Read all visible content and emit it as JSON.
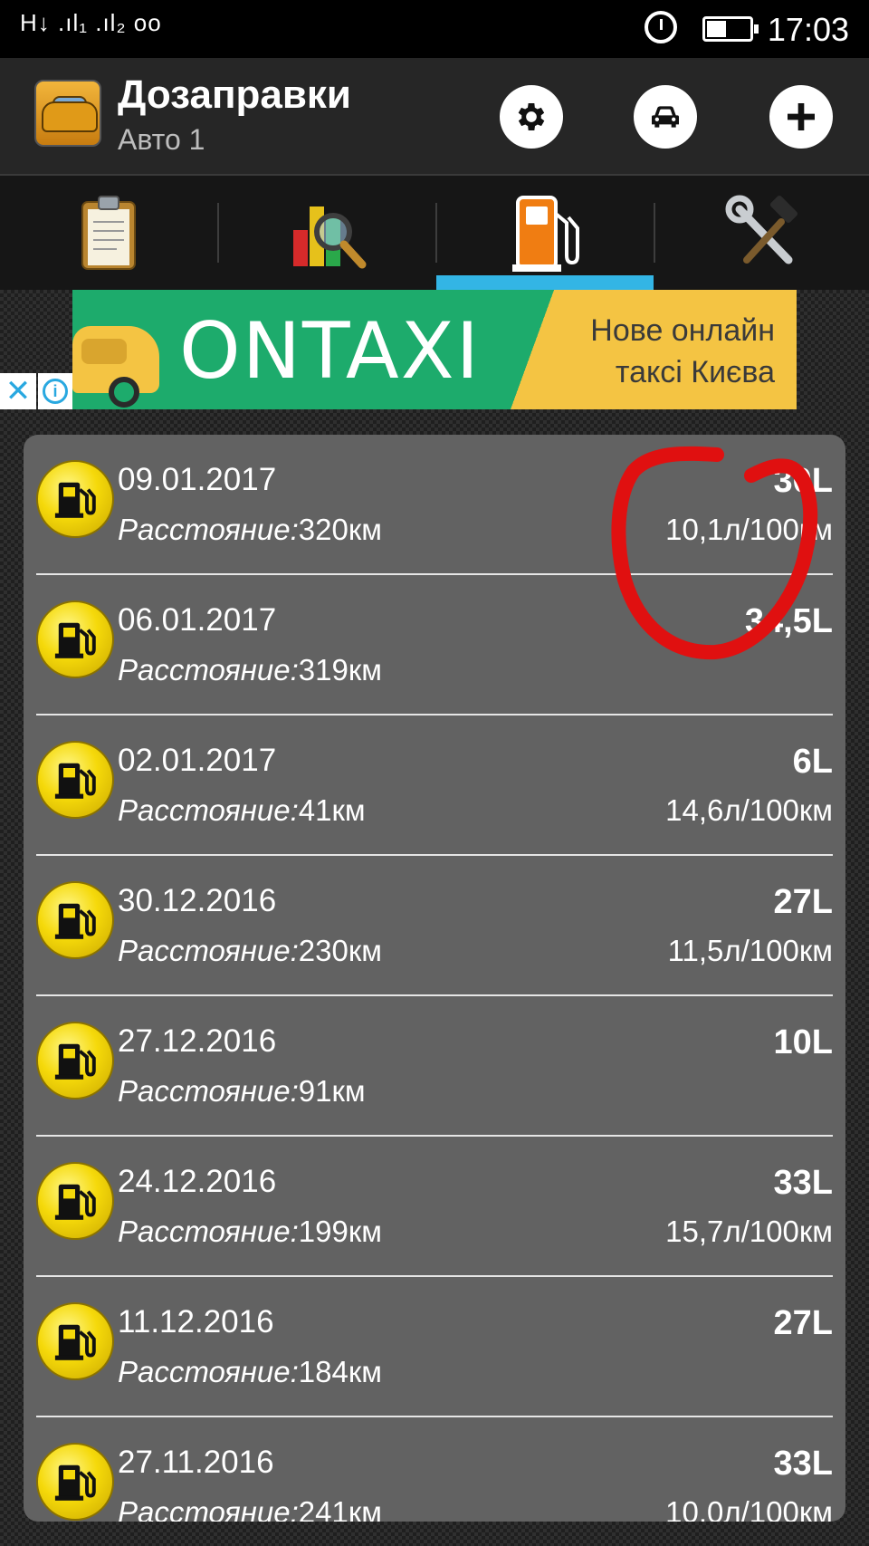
{
  "status_bar": {
    "left": "H↓ .ıl₁ .ıl₂ oo",
    "time": "17:03",
    "battery_level": 0.45
  },
  "header": {
    "title": "Дозаправки",
    "subtitle": "Авто 1"
  },
  "toolbar": {
    "settings_icon": "gear-icon",
    "car_icon": "car-icon",
    "add_icon": "plus-icon"
  },
  "tabs": [
    {
      "icon": "clipboard-icon",
      "selected": false
    },
    {
      "icon": "chart-search-icon",
      "selected": false
    },
    {
      "icon": "fuel-pump-icon",
      "selected": true
    },
    {
      "icon": "tools-icon",
      "selected": false
    }
  ],
  "ad": {
    "logo": "ONTAXI",
    "text": "Нове онлайн таксі Києва",
    "close": "✕",
    "info": "i"
  },
  "colors": {
    "accent": "#33b5e5",
    "list_bg": "#626262",
    "fuel_icon": "#f5d90a",
    "annotation": "#e01010"
  },
  "refuels": [
    {
      "date": "09.01.2017",
      "distance_label": "Расстояние:",
      "distance": "320км",
      "liters": "30L",
      "consumption": "10,1л/100км"
    },
    {
      "date": "06.01.2017",
      "distance_label": "Расстояние:",
      "distance": "319км",
      "liters": "34,5L",
      "consumption": ""
    },
    {
      "date": "02.01.2017",
      "distance_label": "Расстояние:",
      "distance": "41км",
      "liters": "6L",
      "consumption": "14,6л/100км"
    },
    {
      "date": "30.12.2016",
      "distance_label": "Расстояние:",
      "distance": "230км",
      "liters": "27L",
      "consumption": "11,5л/100км"
    },
    {
      "date": "27.12.2016",
      "distance_label": "Расстояние:",
      "distance": "91км",
      "liters": "10L",
      "consumption": ""
    },
    {
      "date": "24.12.2016",
      "distance_label": "Расстояние:",
      "distance": "199км",
      "liters": "33L",
      "consumption": "15,7л/100км"
    },
    {
      "date": "11.12.2016",
      "distance_label": "Расстояние:",
      "distance": "184км",
      "liters": "27L",
      "consumption": ""
    },
    {
      "date": "27.11.2016",
      "distance_label": "Расстояние:",
      "distance": "241км",
      "liters": "33L",
      "consumption": "10,0л/100км"
    }
  ]
}
